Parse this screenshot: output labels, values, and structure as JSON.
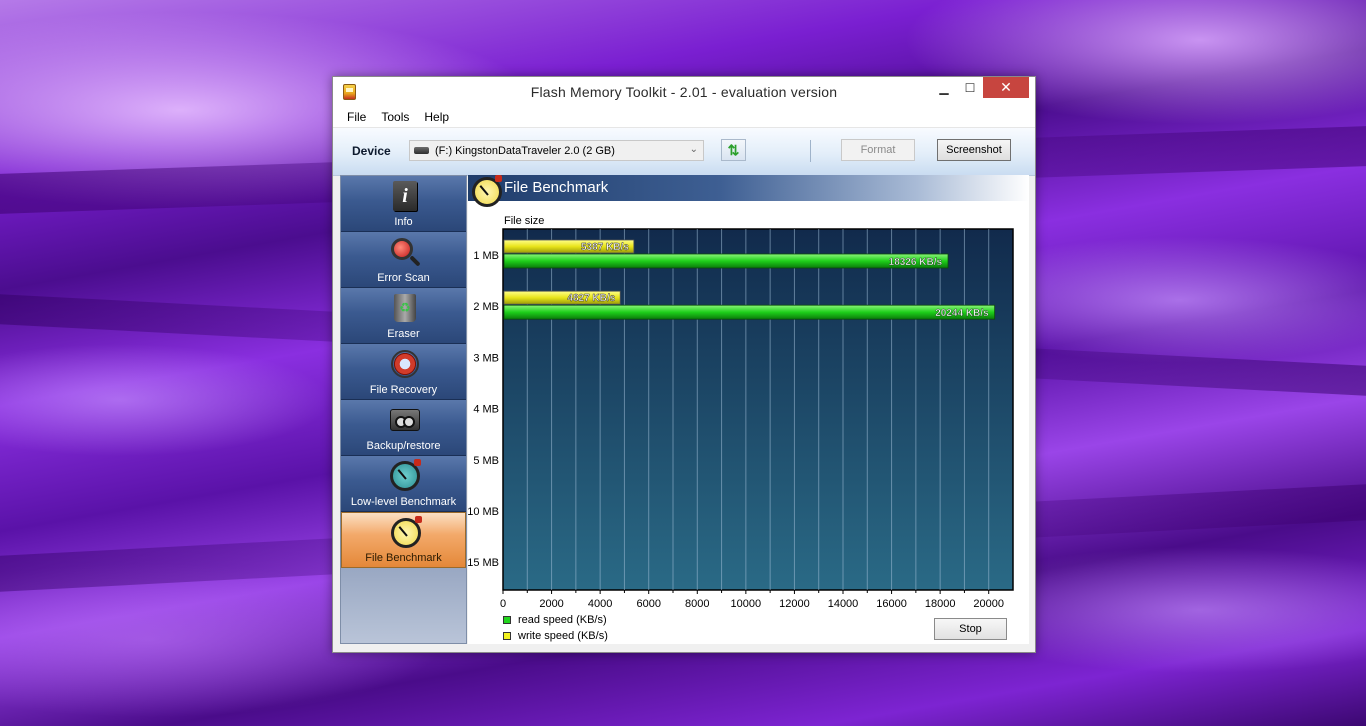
{
  "window": {
    "title": "Flash Memory Toolkit - 2.01 - evaluation version",
    "minimize_glyph": "▁",
    "maximize_glyph": "☐",
    "close_glyph": "✕"
  },
  "menu": [
    "File",
    "Tools",
    "Help"
  ],
  "toolbar": {
    "device_label": "Device",
    "device_value": "(F:) KingstonDataTraveler 2.0 (2 GB)",
    "refresh_glyph": "⇅",
    "format_label": "Format",
    "screenshot_label": "Screenshot"
  },
  "sidebar": {
    "items": [
      {
        "label": "Info",
        "icon": "info-icon"
      },
      {
        "label": "Error Scan",
        "icon": "magnifier-icon"
      },
      {
        "label": "Eraser",
        "icon": "recycle-bin-icon"
      },
      {
        "label": "File Recovery",
        "icon": "lifebuoy-icon"
      },
      {
        "label": "Backup/restore",
        "icon": "tape-icon"
      },
      {
        "label": "Low-level Benchmark",
        "icon": "stopwatch-icon"
      },
      {
        "label": "File Benchmark",
        "icon": "stopwatch-icon",
        "active": true
      }
    ],
    "recycle_glyph": "♻"
  },
  "panel": {
    "title": "File Benchmark",
    "y_title": "File size"
  },
  "chart_data": {
    "type": "bar",
    "orientation": "horizontal",
    "categories": [
      "1 MB",
      "2 MB",
      "3 MB",
      "4 MB",
      "5 MB",
      "10 MB",
      "15 MB"
    ],
    "series": [
      {
        "name": "write speed (KB/s)",
        "color": "#f2f21e",
        "values": [
          5387,
          4827,
          null,
          null,
          null,
          null,
          null
        ],
        "labels": [
          "5387 KB/s",
          "4827 KB/s"
        ]
      },
      {
        "name": "read speed (KB/s)",
        "color": "#22d61e",
        "values": [
          18326,
          20244,
          null,
          null,
          null,
          null,
          null
        ],
        "labels": [
          "18326 KB/s",
          "20244 KB/s"
        ]
      }
    ],
    "x_ticks": [
      0,
      2000,
      4000,
      6000,
      8000,
      10000,
      12000,
      14000,
      16000,
      18000,
      20000
    ],
    "xlim": [
      0,
      21000
    ],
    "grid": true,
    "plot_background": "#1d4a6a"
  },
  "legend": [
    {
      "label": "read speed (KB/s)",
      "color": "#22d61e"
    },
    {
      "label": "write speed (KB/s)",
      "color": "#f2f21e"
    }
  ],
  "stop_label": "Stop"
}
